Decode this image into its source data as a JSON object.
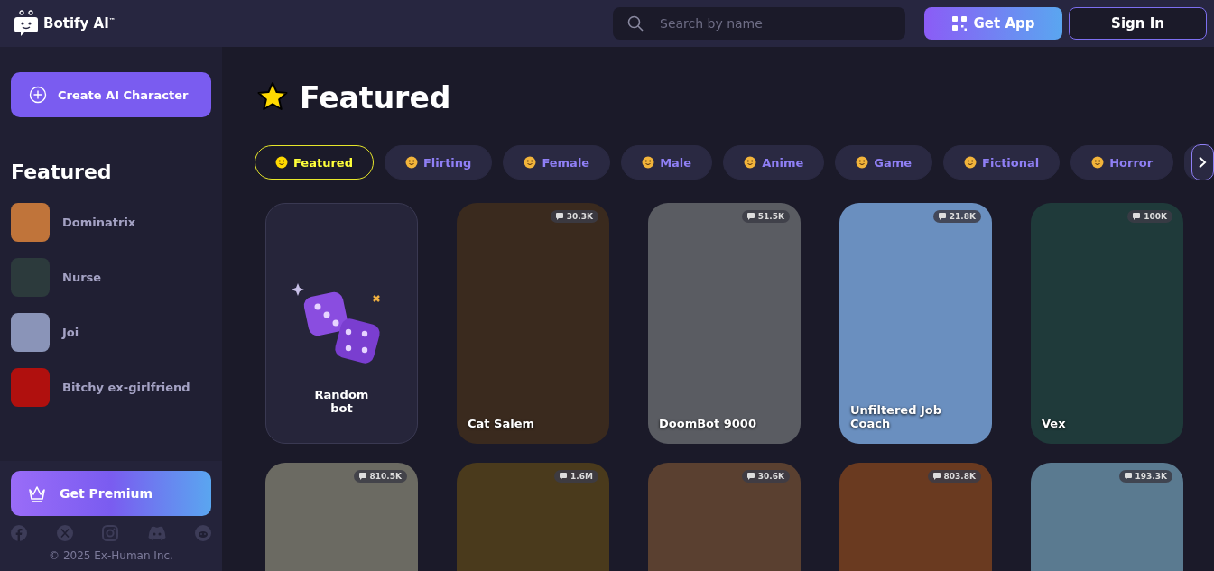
{
  "header": {
    "logo_text": "Botify AI",
    "logo_mark": "™",
    "search": {
      "placeholder": "Search by name"
    },
    "get_app": "Get App",
    "sign_in": "Sign In"
  },
  "sidebar": {
    "create_button": "Create AI Character",
    "section_title": "Featured",
    "items": [
      {
        "name": "Dominatrix",
        "color": "#c0743a"
      },
      {
        "name": "Nurse",
        "color": "#2c3a3c"
      },
      {
        "name": "Joi",
        "color": "#8a94b8"
      },
      {
        "name": "Bitchy ex-girlfriend",
        "color": "#b0100e"
      }
    ],
    "premium_button": "Get Premium",
    "copyright": "© 2025 Ex-Human Inc."
  },
  "main": {
    "title": "Featured",
    "tabs": [
      {
        "label": "Featured",
        "selected": true
      },
      {
        "label": "Flirting",
        "selected": false
      },
      {
        "label": "Female",
        "selected": false
      },
      {
        "label": "Male",
        "selected": false
      },
      {
        "label": "Anime",
        "selected": false
      },
      {
        "label": "Game",
        "selected": false
      },
      {
        "label": "Fictional",
        "selected": false
      },
      {
        "label": "Horror",
        "selected": false
      }
    ],
    "cards": [
      {
        "kind": "random",
        "name": "Random bot"
      },
      {
        "kind": "character",
        "name": "Cat Salem",
        "count": "30.3K",
        "color": "#3a2a1e"
      },
      {
        "kind": "character",
        "name": "DoomBot 9000",
        "count": "51.5K",
        "color": "#5a5c62"
      },
      {
        "kind": "character",
        "name": "Unfiltered Job Coach",
        "count": "21.8K",
        "color": "#6a8fbf"
      },
      {
        "kind": "character",
        "name": "Vex",
        "count": "100K",
        "color": "#1f3a3a"
      },
      {
        "kind": "character",
        "count": "810.5K",
        "color": "#6b6a62"
      },
      {
        "kind": "character",
        "count": "1.6M",
        "color": "#4a3a1c"
      },
      {
        "kind": "character",
        "count": "30.6K",
        "color": "#5a4030"
      },
      {
        "kind": "character",
        "count": "803.8K",
        "color": "#6a3a20"
      },
      {
        "kind": "character",
        "count": "193.3K",
        "color": "#5a7a90"
      }
    ]
  }
}
